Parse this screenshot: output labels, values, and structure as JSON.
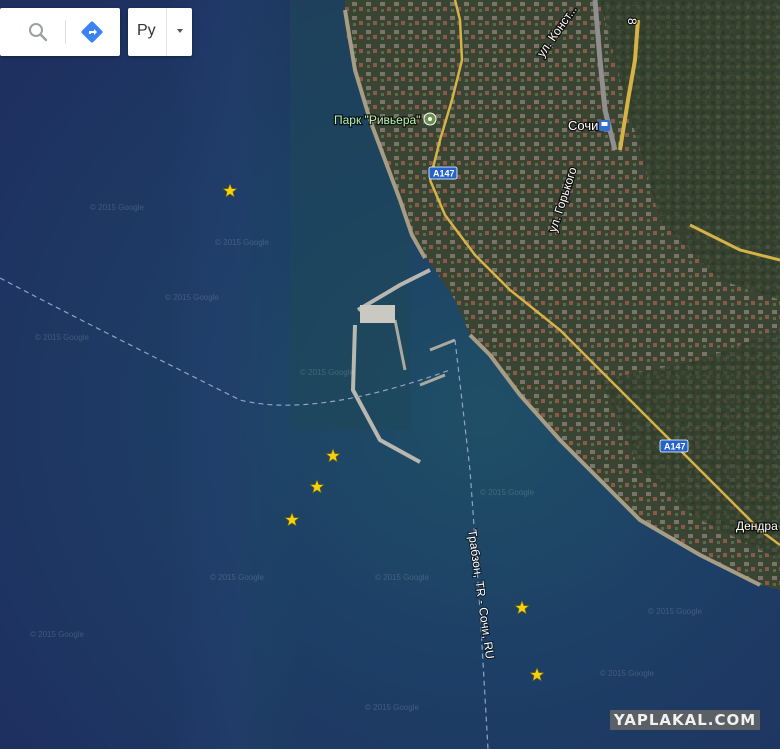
{
  "search": {
    "search_icon": "search-icon",
    "directions_icon": "directions-icon"
  },
  "language": {
    "selected": "Ру",
    "caret_icon": "chevron-down-icon"
  },
  "map": {
    "type": "satellite",
    "labels": {
      "park": "Парк \"Ривьера\"",
      "city": "Сочи",
      "street1": "ул. Конст...",
      "street2": "ул. Горького",
      "district": "Дендра",
      "road_shield_1": "A147",
      "road_shield_2": "A147",
      "road_number": "8",
      "route": "Трабзон, TR - Сочи, RU"
    },
    "copyright_marks": [
      "© 2015 Google",
      "© 2015 Google",
      "© 2015 Google",
      "© 2015 Google",
      "© 2015 Google",
      "© 2015 Google",
      "© 2015 Google",
      "© 2015 Google",
      "© 2015 Google",
      "© 2015 Google",
      "© 2015 Google",
      "© 2015 Google"
    ],
    "markers": [
      "star",
      "star",
      "star",
      "star",
      "star",
      "star"
    ],
    "colors": {
      "sea_deep": "#1e3461",
      "sea_shallow": "#1f4d63",
      "land": "#3c4634",
      "road": "#d7b347",
      "marker": "#f6d20c",
      "route_line": "#8fa2c9"
    }
  },
  "watermark": "YAPLAKAL.COM"
}
